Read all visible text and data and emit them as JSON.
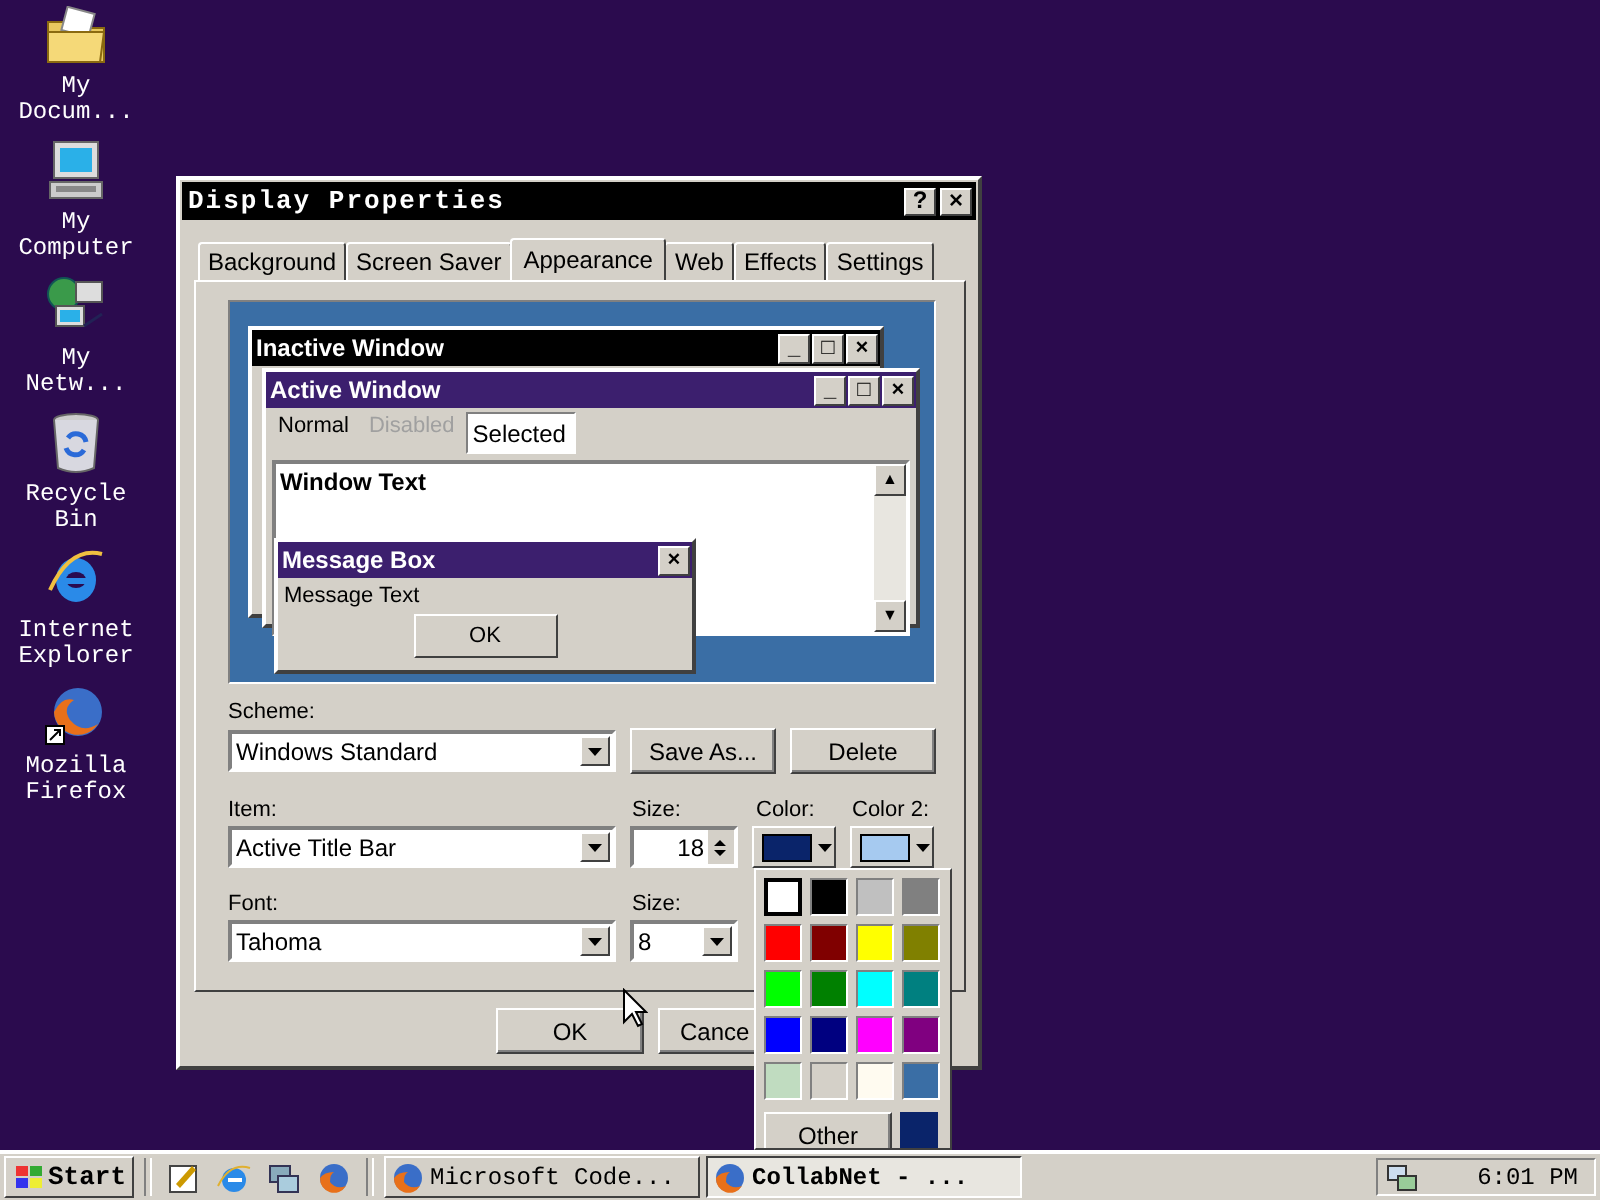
{
  "desktop_icons": [
    {
      "label": "My Docum...",
      "kind": "folder"
    },
    {
      "label": "My Computer",
      "kind": "computer"
    },
    {
      "label": "My Netw...",
      "kind": "network"
    },
    {
      "label": "Recycle Bin",
      "kind": "recycle"
    },
    {
      "label": "Internet Explorer",
      "kind": "browser"
    },
    {
      "label": "Mozilla Firefox",
      "kind": "firefox"
    }
  ],
  "dialog": {
    "title": "Display Properties",
    "title_buttons": [
      "?",
      "×"
    ],
    "tabs": [
      {
        "label": "Background",
        "selected": false
      },
      {
        "label": "Screen Saver",
        "selected": false
      },
      {
        "label": "Appearance",
        "selected": true
      },
      {
        "label": "Web",
        "selected": false
      },
      {
        "label": "Effects",
        "selected": false
      },
      {
        "label": "Settings",
        "selected": false
      }
    ],
    "preview": {
      "inactive_title": "Inactive Window",
      "inactive_buttons": [
        "_",
        "□",
        "×"
      ],
      "active_title": "Active Window",
      "active_buttons": [
        "_",
        "□",
        "×"
      ],
      "menu": [
        {
          "label": "Normal",
          "kind": "normal"
        },
        {
          "label": "Disabled",
          "kind": "disabled"
        },
        {
          "label": "Selected",
          "kind": "selected"
        }
      ],
      "window_text": "Window Text",
      "scroll_arrows": [
        "▲",
        "▼"
      ],
      "message_box": {
        "title": "Message Box",
        "close": "×",
        "text": "Message Text",
        "button": "OK"
      }
    },
    "scheme": {
      "label": "Scheme:",
      "value": "Windows Standard",
      "save_button": "Save As...",
      "delete_button": "Delete"
    },
    "item": {
      "label": "Item:",
      "value": "Active Title Bar",
      "size_label": "Size:",
      "size": "18",
      "color_label": "Color:",
      "color": "#0a246a",
      "color2": {
        "label": "Color 2:",
        "color": "#a6caf0"
      }
    },
    "font": {
      "label": "Font:",
      "value": "Tahoma",
      "size_label": "Size:",
      "size": "8"
    },
    "buttons": [
      "OK",
      "Cance"
    ]
  },
  "color_popup": {
    "colors": [
      {
        "color": "#ffffff",
        "selected": true
      },
      {
        "color": "#000000",
        "selected": false
      },
      {
        "color": "#c0c0c0",
        "selected": false
      },
      {
        "color": "#808080",
        "selected": false
      },
      {
        "color": "#ff0000",
        "selected": false
      },
      {
        "color": "#800000",
        "selected": false
      },
      {
        "color": "#ffff00",
        "selected": false
      },
      {
        "color": "#808000",
        "selected": false
      },
      {
        "color": "#00ff00",
        "selected": false
      },
      {
        "color": "#008000",
        "selected": false
      },
      {
        "color": "#00ffff",
        "selected": false
      },
      {
        "color": "#008080",
        "selected": false
      },
      {
        "color": "#0000ff",
        "selected": false
      },
      {
        "color": "#000080",
        "selected": false
      },
      {
        "color": "#ff00ff",
        "selected": false
      },
      {
        "color": "#800080",
        "selected": false
      },
      {
        "color": "#c0dcc0",
        "selected": false
      },
      {
        "color": "#d4d0c8",
        "selected": false
      },
      {
        "color": "#fffbf0",
        "selected": false
      },
      {
        "color": "#3a6ea5",
        "selected": false
      }
    ],
    "other_button": "Other",
    "custom_swatch": {
      "color": "#0a246a"
    }
  },
  "taskbar": {
    "start": "Start",
    "quick_launch": [
      {
        "kind": "note"
      },
      {
        "kind": "browser"
      },
      {
        "kind": "swap"
      },
      {
        "kind": "firefox"
      }
    ],
    "tasks": [
      {
        "label": "Microsoft Code...",
        "selected": false
      },
      {
        "label": "CollabNet - ...",
        "selected": true
      }
    ],
    "clock": "6:01 PM"
  }
}
